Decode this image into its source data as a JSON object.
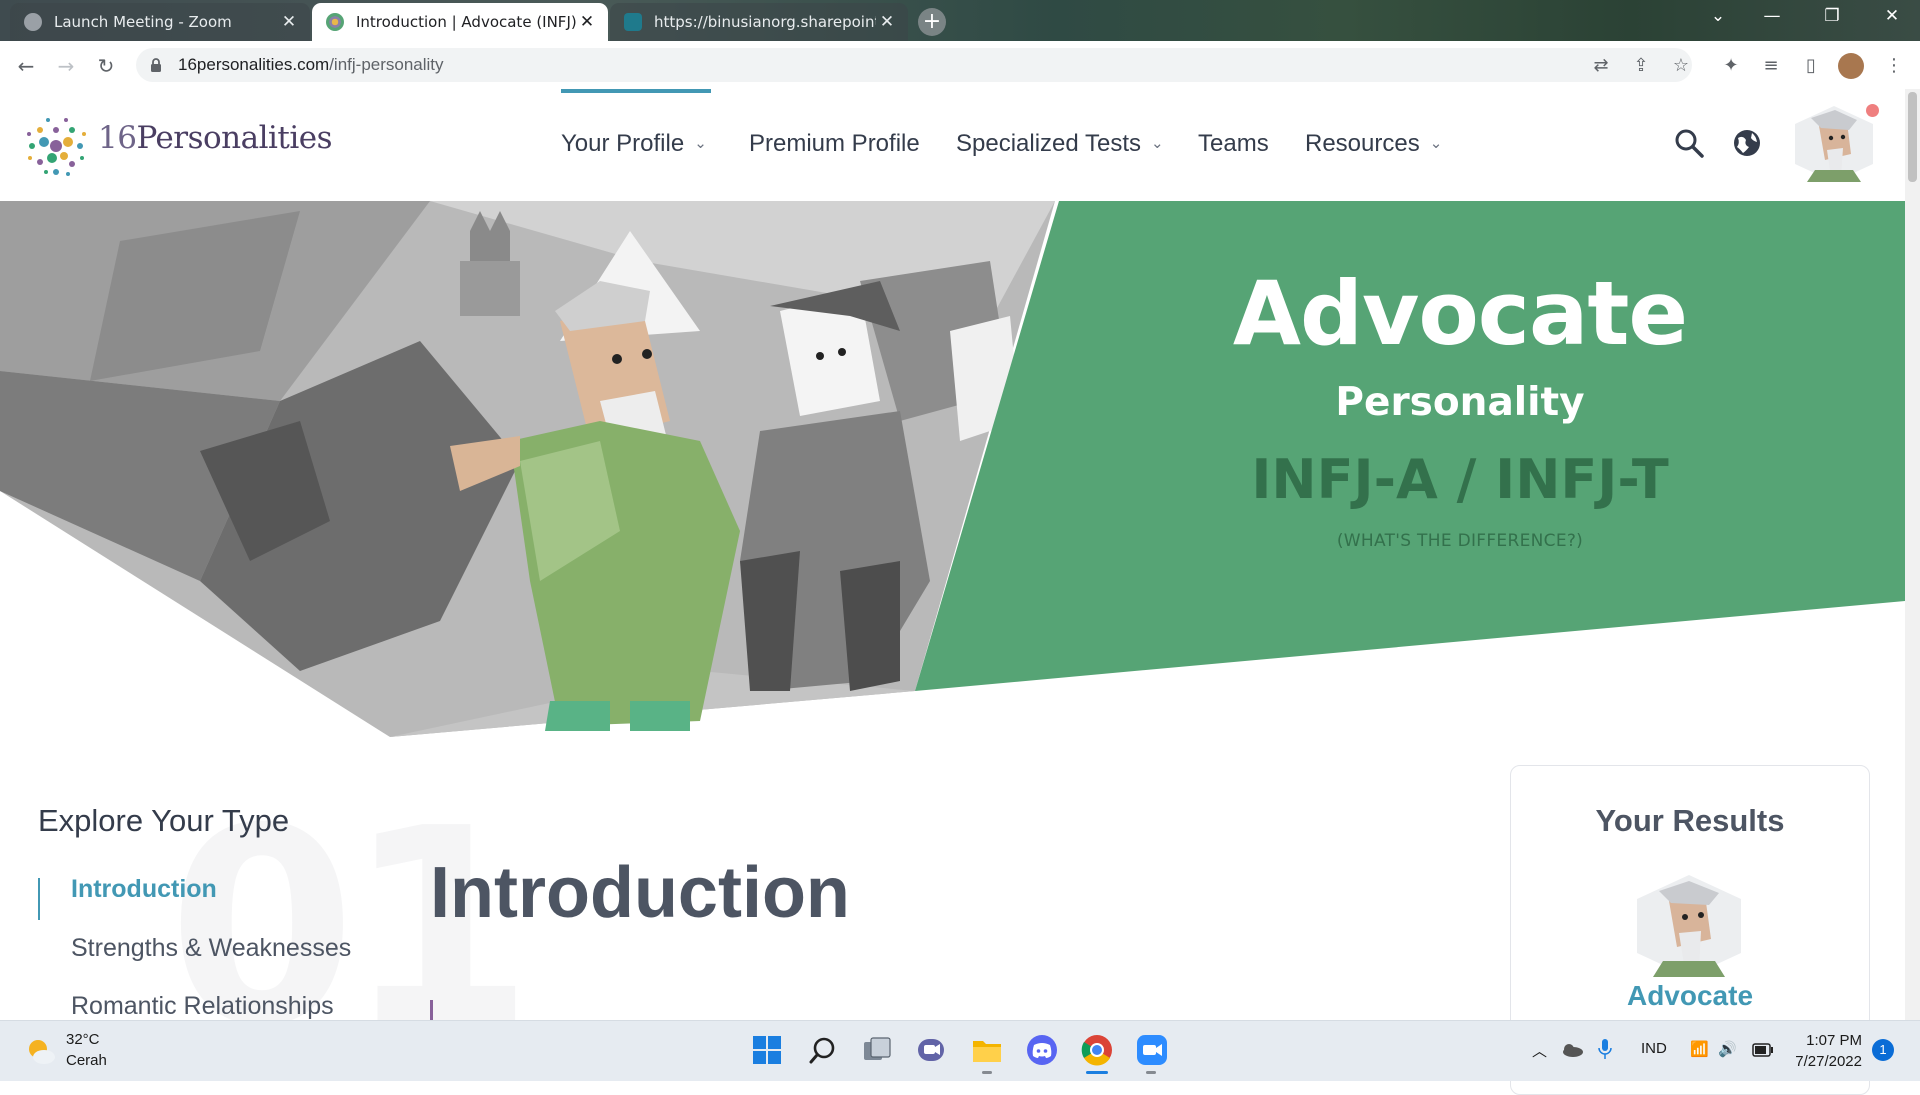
{
  "browser": {
    "tabs": [
      {
        "title": "Launch Meeting - Zoom",
        "favicon_color": "#9aa0a6"
      },
      {
        "title": "Introduction | Advocate (INFJ) Pe",
        "favicon_color": "#8a7fa8"
      },
      {
        "title": "https://binusianorg.sharepoint.co",
        "favicon_color": "#1f7a8c"
      }
    ],
    "new_tab_glyph": "+",
    "close_glyph": "✕",
    "url_host": "16personalities.com",
    "url_path": "/infj-personality"
  },
  "site": {
    "logo_number": "16",
    "logo_name": "Personalities",
    "nav": [
      {
        "label": "Your Profile",
        "dropdown": true
      },
      {
        "label": "Premium Profile",
        "dropdown": false
      },
      {
        "label": "Specialized Tests",
        "dropdown": true
      },
      {
        "label": "Teams",
        "dropdown": false
      },
      {
        "label": "Resources",
        "dropdown": true
      }
    ],
    "accent": "#4298b4",
    "hero_green": "#56a475"
  },
  "hero": {
    "title": "Advocate",
    "subtitle": "Personality",
    "type_code": "INFJ-A / INFJ-T",
    "difference_link": "(WHAT'S THE DIFFERENCE?)"
  },
  "sidebar": {
    "title": "Explore Your Type",
    "items": [
      {
        "label": "Introduction",
        "active": true
      },
      {
        "label": "Strengths & Weaknesses",
        "active": false
      },
      {
        "label": "Romantic Relationships",
        "active": false
      }
    ]
  },
  "main": {
    "section_number": "01",
    "heading": "Introduction"
  },
  "results": {
    "title": "Your Results",
    "type_name": "Advocate"
  },
  "taskbar": {
    "weather_temp": "32°C",
    "weather_desc": "Cerah",
    "language": "IND",
    "time": "1:07 PM",
    "date": "7/27/2022",
    "notification_count": "1"
  }
}
